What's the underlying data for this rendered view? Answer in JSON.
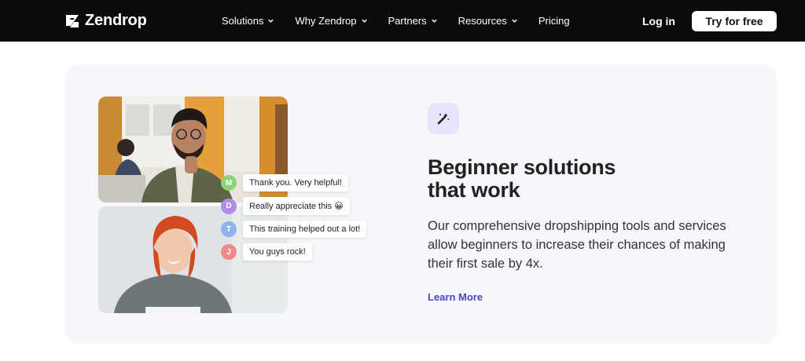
{
  "nav": {
    "brand": "Zendrop",
    "menu": [
      {
        "label": "Solutions",
        "has_dropdown": true
      },
      {
        "label": "Why Zendrop",
        "has_dropdown": true
      },
      {
        "label": "Partners",
        "has_dropdown": true
      },
      {
        "label": "Resources",
        "has_dropdown": true
      },
      {
        "label": "Pricing",
        "has_dropdown": false
      }
    ],
    "login_label": "Log in",
    "cta_label": "Try for free"
  },
  "hero": {
    "headline_line1": "Beginner solutions",
    "headline_line2": "that work",
    "description": "Our comprehensive dropshipping tools and services allow beginners to increase their chances of making their first sale by 4x.",
    "link_label": "Learn More",
    "badge_icon": "magic-wand-icon"
  },
  "chats": [
    {
      "initial": "M",
      "text": "Thank you. Very helpful!",
      "color": "#8ed37a"
    },
    {
      "initial": "D",
      "text": "Really appreciate this 😀",
      "color": "#b48be6"
    },
    {
      "initial": "T",
      "text": "This training helped out a lot!",
      "color": "#8cb4ef"
    },
    {
      "initial": "J",
      "text": "You guys rock!",
      "color": "#f08a8a"
    }
  ],
  "colors": {
    "nav_bg": "#0b0b0b",
    "card_bg": "#f6f7fb",
    "accent": "#4c47c6",
    "badge_bg": "#e7e5fb"
  }
}
